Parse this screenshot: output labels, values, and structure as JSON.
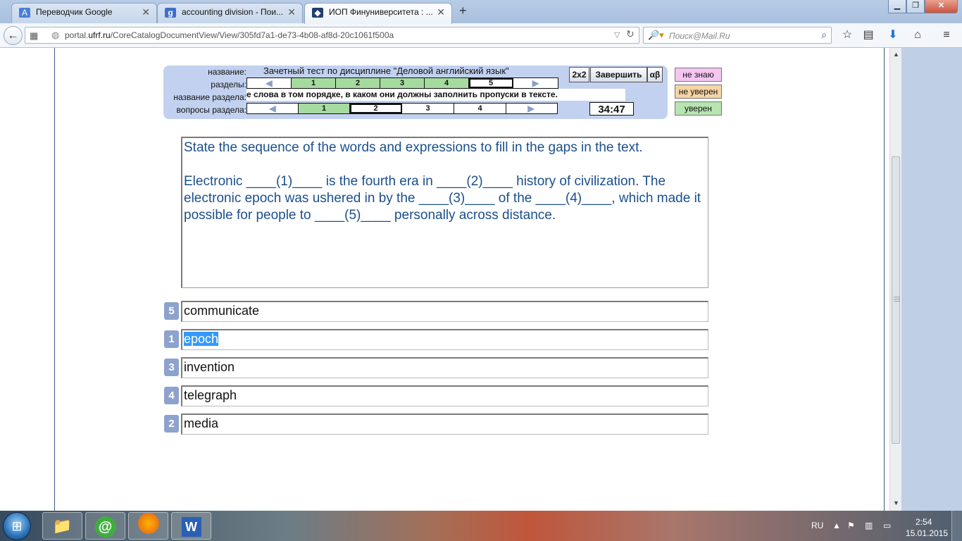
{
  "browser": {
    "tabs": [
      {
        "label": "Переводчик Google",
        "icon": "google-translate-icon"
      },
      {
        "label": "accounting division - Пои...",
        "icon": "google-search-icon"
      },
      {
        "label": "ИОП Финуниверситета : ...",
        "icon": "graduation-cap-icon",
        "active": true
      }
    ],
    "new_tab": "+",
    "url_host": "portal.",
    "url_domain": "ufrf.ru",
    "url_path": "/CoreCatalogDocumentView/View/305fd7a1-de73-4b08-af8d-20c1061f500a",
    "search_placeholder": "Поиск@Mail.Ru"
  },
  "test_header": {
    "label_title": "название:",
    "label_sections": "разделы:",
    "label_section_name": "название раздела:",
    "label_questions": "вопросы раздела:",
    "title": "Зачетный тест по дисциплине \"Деловой английский язык\"",
    "sections": [
      {
        "label": "◀",
        "state": "arrow"
      },
      {
        "label": "1",
        "state": "done"
      },
      {
        "label": "2",
        "state": "done"
      },
      {
        "label": "3",
        "state": "done"
      },
      {
        "label": "4",
        "state": "done"
      },
      {
        "label": "5",
        "state": "current"
      },
      {
        "label": "▶",
        "state": "arrow"
      }
    ],
    "section_name": "е слова в том порядке, в каком они должны заполнить пропуски в тексте.",
    "questions": [
      {
        "label": "◀",
        "state": "arrow"
      },
      {
        "label": "1",
        "state": "done"
      },
      {
        "label": "2",
        "state": "current"
      },
      {
        "label": "3",
        "state": "plain"
      },
      {
        "label": "4",
        "state": "plain"
      },
      {
        "label": "▶",
        "state": "arrow"
      }
    ],
    "btn_2x2": "2x2",
    "btn_finish": "Завершить",
    "btn_alpha": "αβ",
    "timer": "34:47",
    "confidence": {
      "dont_know": "не знаю",
      "not_sure": "не уверен",
      "sure": "уверен"
    },
    "colors": {
      "dont_know": "#f5c6f1",
      "not_sure": "#f6d4a5",
      "sure": "#b7e4b0",
      "panel": "#c2d1ef"
    }
  },
  "question": {
    "instruction": "State the sequence of the words and expressions to fill in the gaps in the text.",
    "text": "Electronic ____(1)____ is the fourth era in ____(2)____ history of civilization. The electronic epoch was ushered in by the ____(3)____ of the ____(4)____, which made it possible for people to ____(5)____ personally across distance."
  },
  "answers": [
    {
      "order": "5",
      "text": "communicate",
      "selected": false
    },
    {
      "order": "1",
      "text": "epoch",
      "selected": true
    },
    {
      "order": "3",
      "text": "invention",
      "selected": false
    },
    {
      "order": "4",
      "text": "telegraph",
      "selected": false
    },
    {
      "order": "2",
      "text": "media",
      "selected": false
    }
  ],
  "taskbar": {
    "start_icon": "windows-logo",
    "apps": [
      "file-explorer-icon",
      "mail-agent-icon",
      "firefox-icon",
      "word-icon"
    ],
    "lang": "RU",
    "time": "2:54",
    "date": "15.01.2015"
  }
}
